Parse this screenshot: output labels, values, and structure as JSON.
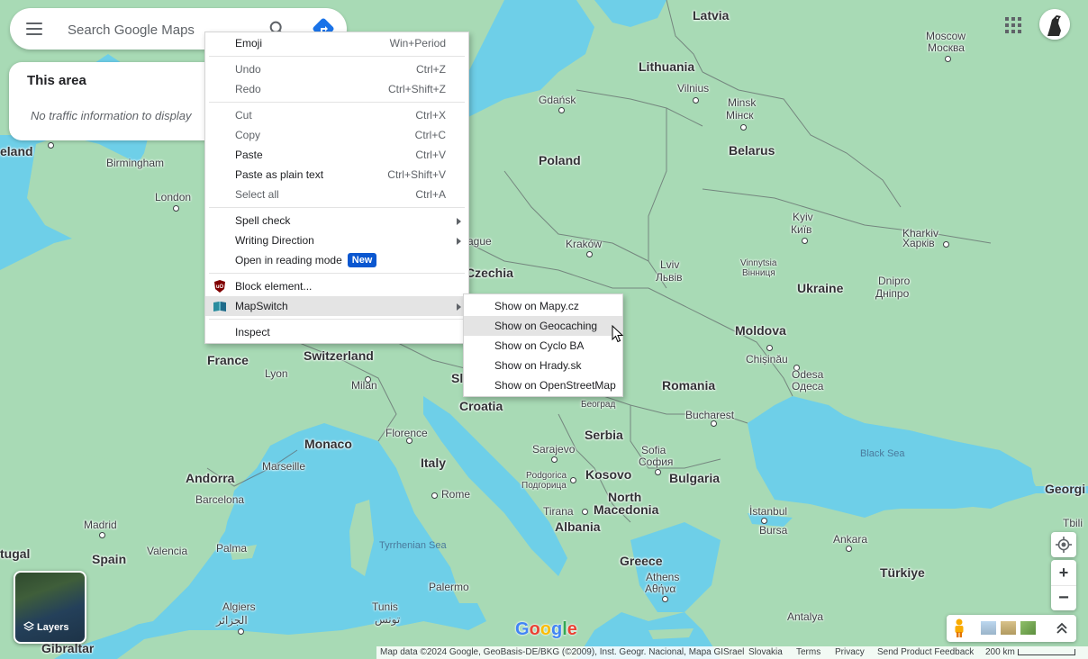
{
  "search": {
    "placeholder": "Search Google Maps"
  },
  "traffic_panel": {
    "title": "This area",
    "message": "No traffic information to display"
  },
  "context_menu": {
    "items": [
      {
        "label": "Emoji",
        "shortcut": "Win+Period"
      },
      {
        "label": "Undo",
        "shortcut": "Ctrl+Z"
      },
      {
        "label": "Redo",
        "shortcut": "Ctrl+Shift+Z"
      },
      {
        "label": "Cut",
        "shortcut": "Ctrl+X"
      },
      {
        "label": "Copy",
        "shortcut": "Ctrl+C"
      },
      {
        "label": "Paste",
        "shortcut": "Ctrl+V"
      },
      {
        "label": "Paste as plain text",
        "shortcut": "Ctrl+Shift+V"
      },
      {
        "label": "Select all",
        "shortcut": "Ctrl+A"
      },
      {
        "label": "Spell check"
      },
      {
        "label": "Writing Direction"
      },
      {
        "label": "Open in reading mode",
        "badge": "New"
      },
      {
        "label": "Block element...",
        "icon": "ublock-origin-icon"
      },
      {
        "label": "MapSwitch",
        "icon": "map-book-icon"
      },
      {
        "label": "Inspect"
      }
    ]
  },
  "submenu": {
    "items": [
      {
        "label": "Show on Mapy.cz"
      },
      {
        "label": "Show on Geocaching"
      },
      {
        "label": "Show on Cyclo BA"
      },
      {
        "label": "Show on Hrady.sk"
      },
      {
        "label": "Show on OpenStreetMap"
      }
    ]
  },
  "map": {
    "labels": {
      "latvia": "Latvia",
      "lithuania": "Lithuania",
      "vilnius": "Vilnius",
      "minsk": "Minsk",
      "minsk_local": "Мінск",
      "moscow": "Moscow",
      "moscow_local": "Москва",
      "gdansk": "Gdańsk",
      "belarus": "Belarus",
      "poland": "Poland",
      "ireland": "eland",
      "birmingham": "Birmingham",
      "london": "London",
      "kyiv": "Kyiv",
      "kyiv_local": "Київ",
      "kharkiv": "Kharkiv",
      "kharkiv_local": "Харків",
      "lviv": "Lviv",
      "lviv_local": "Львів",
      "krakow": "Kraków",
      "prague": "ague",
      "czechia": "Czechia",
      "vinnytsia": "Vinnytsia",
      "vinnytsia_local": "Вінниця",
      "ukraine": "Ukraine",
      "dnipro": "Dnipro",
      "dnipro_local": "Дніпро",
      "moldova": "Moldova",
      "chisinau": "Chișinău",
      "odesa": "Odesa",
      "odesa_local": "Одеса",
      "france": "France",
      "switzerland": "Switzerland",
      "lyon": "Lyon",
      "milan": "Milan",
      "slovenia": "Sl",
      "croatia": "Croatia",
      "belgrade_local": "Београд",
      "romania": "Romania",
      "bucharest": "Bucharest",
      "serbia": "Serbia",
      "monaco": "Monaco",
      "florence": "Florence",
      "italy": "Italy",
      "sarajevo": "Sarajevo",
      "sofia": "Sofia",
      "sofia_local": "София",
      "bulgaria": "Bulgaria",
      "black_sea": "Black Sea",
      "marseille": "Marseille",
      "andorra": "Andorra",
      "barcelona": "Barcelona",
      "podgorica": "Podgorica",
      "podgorica_local": "Подгорица",
      "kosovo": "Kosovo",
      "rome": "Rome",
      "north_macedonia_1": "North",
      "north_macedonia_2": "Macedonia",
      "istanbul": "İstanbul",
      "georgia": "Georgi",
      "tbilisi": "Tbili",
      "madrid": "Madrid",
      "valencia": "Valencia",
      "tirana": "Tirana",
      "albania": "Albania",
      "bursa": "Bursa",
      "ankara": "Ankara",
      "portugal": "tugal",
      "spain": "Spain",
      "palma": "Palma",
      "tyrrhenian_sea": "Tyrrhenian Sea",
      "greece": "Greece",
      "turkiye": "Türkiye",
      "athens": "Athens",
      "athens_local": "Αθήνα",
      "palermo": "Palermo",
      "algiers": "Algiers",
      "algiers_local": "الجزائر",
      "tunis": "Tunis",
      "tunis_local": "تونس",
      "antalya": "Antalya",
      "gibraltar": "Gibraltar"
    }
  },
  "layers": {
    "label": "Layers"
  },
  "logo": "Google",
  "footer": {
    "attribution": "Map data ©2024 Google, GeoBasis-DE/BKG (©2009), Inst. Geogr. Nacional, Mapa GISrael",
    "region": "Slovakia",
    "terms": "Terms",
    "privacy": "Privacy",
    "feedback": "Send Product Feedback",
    "scale": "200 km"
  },
  "colors": {
    "land": "#a8dab5",
    "water": "#6ecfe8",
    "menu_highlight": "#e4e4e4",
    "badge": "#0b57d0"
  }
}
